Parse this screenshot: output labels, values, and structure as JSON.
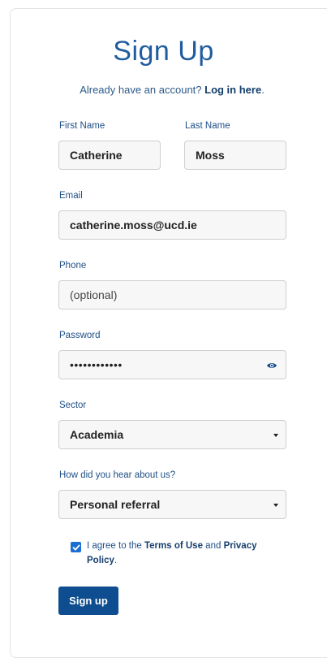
{
  "header": {
    "title": "Sign Up",
    "subtitle_prefix": "Already have an account? ",
    "login_link": "Log in here",
    "subtitle_suffix": "."
  },
  "form": {
    "first_name": {
      "label": "First Name",
      "value": "Catherine"
    },
    "last_name": {
      "label": "Last Name",
      "value": "Moss"
    },
    "email": {
      "label": "Email",
      "value": "catherine.moss@ucd.ie"
    },
    "phone": {
      "label": "Phone",
      "placeholder": "(optional)"
    },
    "password": {
      "label": "Password",
      "masked_value": "••••••••••••"
    },
    "sector": {
      "label": "Sector",
      "selected": "Academia"
    },
    "referral": {
      "label": "How did you hear about us?",
      "selected": "Personal referral"
    },
    "agree": {
      "checked": true,
      "text_prefix": "I agree to the ",
      "terms": "Terms of Use",
      "and": " and ",
      "privacy": "Privacy Policy",
      "suffix": "."
    },
    "submit_label": "Sign up"
  },
  "colors": {
    "title": "#1f5c9e",
    "label": "#1f4f86",
    "button": "#0e4d8f",
    "checkbox": "#1a6fd1"
  },
  "icons": {
    "password_toggle": "eye-icon",
    "select_caret": "caret-down-icon",
    "checkbox_mark": "check-icon"
  }
}
